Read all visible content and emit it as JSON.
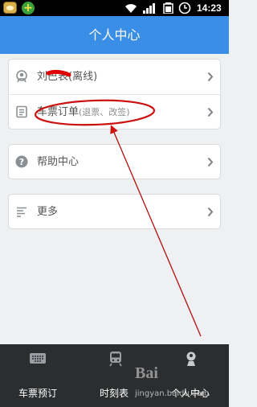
{
  "status_bar": {
    "time": "14:23",
    "icons": [
      "app-icon",
      "plus-app-icon",
      "wifi-icon",
      "signal-icon",
      "battery-icon",
      "alarm-clock-icon"
    ]
  },
  "header": {
    "title": "个人中心"
  },
  "menu": {
    "user": {
      "name": "刘巴表",
      "status": "(离线)",
      "icon": "user-icon"
    },
    "orders": {
      "label": "车票订单",
      "hint": "(退票、改签)",
      "icon": "order-list-icon"
    },
    "help": {
      "label": "帮助中心",
      "icon": "help-icon"
    },
    "more": {
      "label": "更多",
      "icon": "more-lines-icon"
    }
  },
  "bottom_nav": {
    "items": [
      {
        "label": "车票预订",
        "icon": "keyboard-icon"
      },
      {
        "label": "时刻表",
        "icon": "train-icon"
      },
      {
        "label": "个人中心",
        "icon": "person-icon"
      }
    ]
  },
  "watermark": {
    "text": "jingyan.baidu.com",
    "logo": "Bai"
  },
  "colors": {
    "header_bg": "#3a8ee6",
    "nav_bg": "#2b2d2f",
    "annotation": "#cc1111"
  }
}
